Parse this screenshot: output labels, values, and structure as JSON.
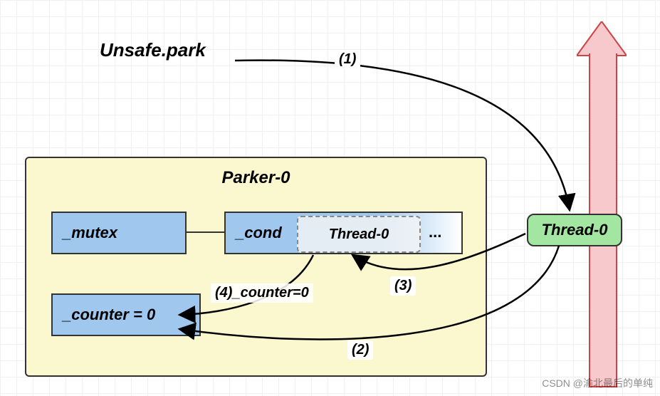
{
  "title": "Unsafe.park",
  "parker": {
    "title": "Parker-0",
    "mutex": "_mutex",
    "cond": "_cond",
    "cond_thread": "Thread-0",
    "cond_ellipsis": "...",
    "counter": "_counter = 0"
  },
  "thread_node": "Thread-0",
  "steps": {
    "s1": "(1)",
    "s2": "(2)",
    "s3": "(3)",
    "s4": "(4)_counter=0"
  },
  "watermark": "CSDN @渝北最后的单纯"
}
